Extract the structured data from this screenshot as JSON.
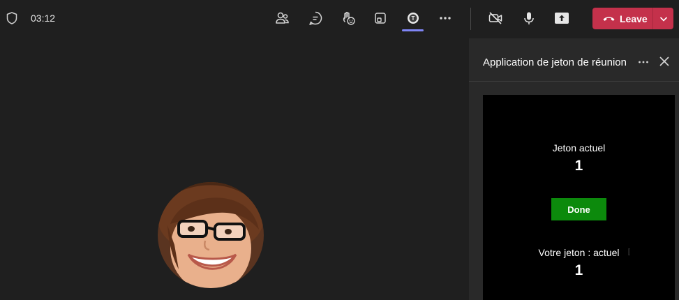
{
  "topbar": {
    "timer": "03:12",
    "leave_label": "Leave",
    "icons": [
      "shield-icon",
      "people-icon",
      "chat-icon",
      "react-icon",
      "view-icon",
      "meeting-token-app-icon",
      "more-icon",
      "camera-off-icon",
      "mic-icon",
      "share-icon",
      "phone-hangup-icon",
      "chevron-down-icon"
    ],
    "accent_color": "#7f85f5",
    "leave_color": "#c4314b"
  },
  "panel": {
    "title": "Application de jeton de réunion"
  },
  "token_app": {
    "current_label": "Jeton actuel",
    "current_value": "1",
    "done_label": "Done",
    "your_label": "Votre jeton : actuel",
    "your_value": "1",
    "done_color": "#0c8a0c"
  }
}
